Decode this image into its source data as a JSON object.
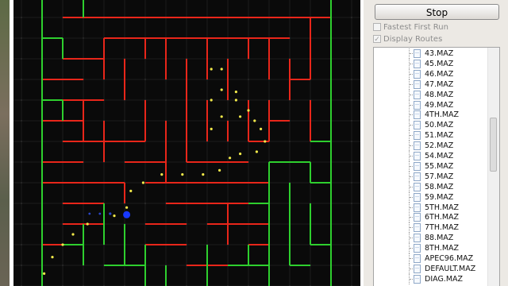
{
  "controls": {
    "stop_label": "Stop",
    "fastest_first_run": {
      "label": "Fastest First Run",
      "checked": false
    },
    "display_routes": {
      "label": "Display Routes",
      "checked": true
    }
  },
  "files": [
    "43.MAZ",
    "45.MAZ",
    "46.MAZ",
    "47.MAZ",
    "48.MAZ",
    "49.MAZ",
    "4TH.MAZ",
    "50.MAZ",
    "51.MAZ",
    "52.MAZ",
    "54.MAZ",
    "55.MAZ",
    "57.MAZ",
    "58.MAZ",
    "59.MAZ",
    "5TH.MAZ",
    "6TH.MAZ",
    "7TH.MAZ",
    "88.MAZ",
    "8TH.MAZ",
    "APEC96.MAZ",
    "DEFAULT.MAZ",
    "DIAG.MAZ"
  ],
  "colors": {
    "maze_background": "#0a0a0a",
    "wall_explored": "#e8261a",
    "wall_unexplored": "#2ecf2e",
    "route_dot": "#f2e94a",
    "robot": "#1738ff"
  },
  "icons": {
    "file": "file-icon"
  }
}
